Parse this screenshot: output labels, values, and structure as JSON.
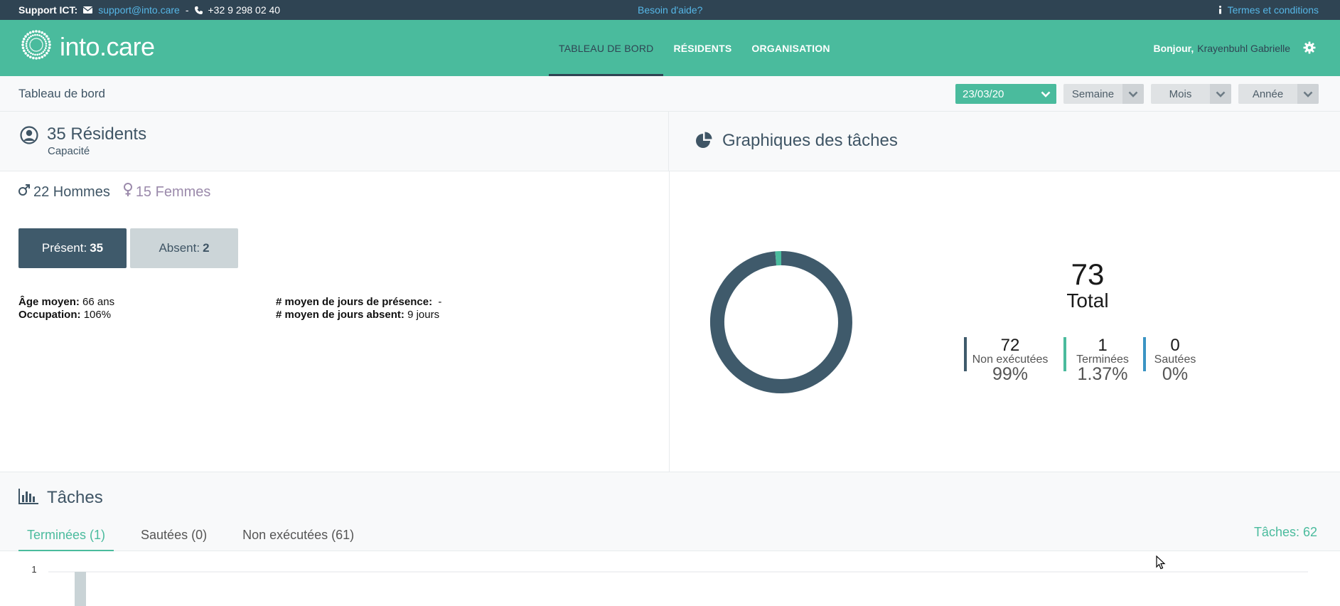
{
  "topbar": {
    "support_label": "Support ICT:",
    "email": "support@into.care",
    "separator": "-",
    "phone": "+32 9 298 02 40",
    "help_link": "Besoin d'aide?",
    "terms_link": "Termes et conditions",
    "icons": [
      "envelope-icon",
      "phone-icon",
      "info-icon"
    ]
  },
  "nav": {
    "brand": "into.care",
    "menu": [
      {
        "label": "TABLEAU DE BORD",
        "active": true
      },
      {
        "label": "RÉSIDENTS",
        "active": false
      },
      {
        "label": "ORGANISATION",
        "active": false
      }
    ],
    "greeting": "Bonjour,",
    "user_name": "Krayenbuhl Gabrielle"
  },
  "subheader": {
    "title": "Tableau de bord",
    "filters": [
      {
        "value": "23/03/20",
        "style": "date"
      },
      {
        "value": "Semaine",
        "style": "grey"
      },
      {
        "value": "Mois",
        "style": "grey"
      },
      {
        "value": "Année",
        "style": "grey"
      }
    ]
  },
  "residents": {
    "title": "35 Résidents",
    "subtitle": "Capacité",
    "men": "22 Hommes",
    "women": "15 Femmes",
    "present_label": "Présent:",
    "present_value": "35",
    "absent_label": "Absent:",
    "absent_value": "2",
    "stats_left": [
      {
        "key": "Âge moyen:",
        "value": "66 ans"
      },
      {
        "key": "Occupation:",
        "value": "106%"
      }
    ],
    "stats_right": [
      {
        "key": "# moyen de jours de présence:",
        "value": "-"
      },
      {
        "key": "# moyen de jours absent:",
        "value": "9 jours"
      }
    ]
  },
  "task_chart": {
    "title": "Graphiques des tâches",
    "total_value": "73",
    "total_label": "Total",
    "legend": [
      {
        "count": "72",
        "label": "Non exécutées",
        "percent": "99%",
        "color": "#3f5a6b"
      },
      {
        "count": "1",
        "label": "Terminées",
        "percent": "1.37%",
        "color": "#4abb9d"
      },
      {
        "count": "0",
        "label": "Sautées",
        "percent": "0%",
        "color": "#3a94c4"
      }
    ],
    "slices": [
      72,
      1,
      0
    ],
    "colors": [
      "#3f5a6b",
      "#4abb9d",
      "#3a94c4"
    ]
  },
  "tasks": {
    "title": "Tâches",
    "tabs": [
      {
        "label": "Terminées (1)",
        "active": true
      },
      {
        "label": "Sautées (0)",
        "active": false
      },
      {
        "label": "Non exécutées (61)",
        "active": false
      }
    ],
    "count_label": "Tâches: 62",
    "chart": {
      "y_tick": "1",
      "bar_values": [
        1
      ],
      "y_max": 1,
      "bar_color": "#c9d3d6"
    }
  },
  "colors": {
    "topbar": "#2f4453",
    "nav": "#4abb9d",
    "accent": "#4abb9d",
    "dark": "#3f5a6b",
    "link": "#56b6e6"
  }
}
